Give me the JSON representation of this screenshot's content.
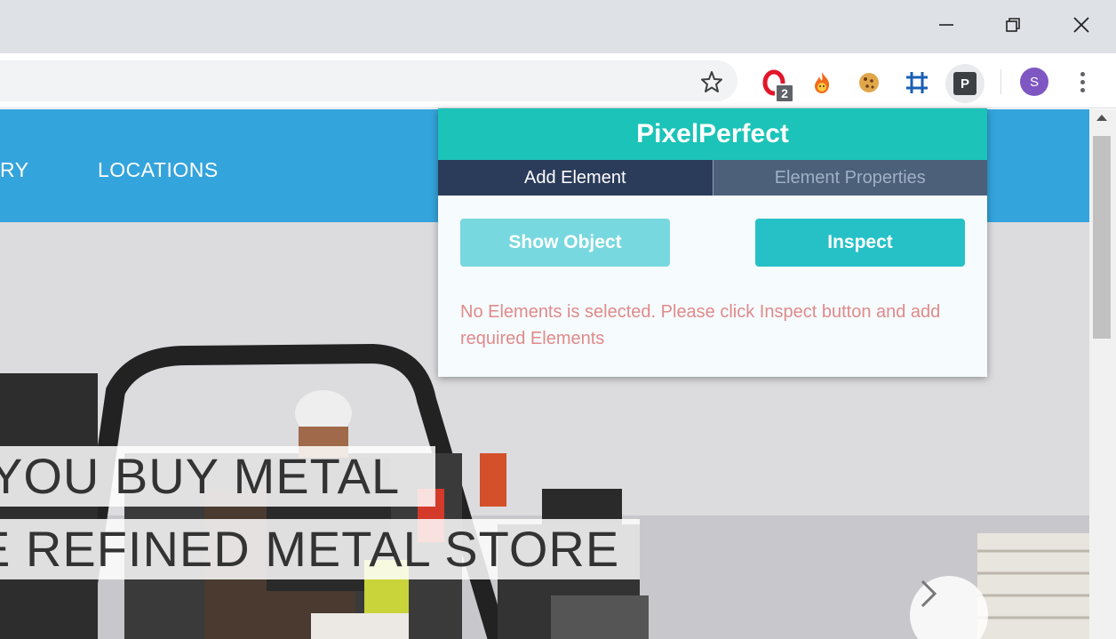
{
  "window": {
    "minimize_icon": "minimize-icon",
    "restore_icon": "restore-icon",
    "close_icon": "close-icon"
  },
  "toolbar": {
    "extensions": {
      "opera_badge": "2",
      "pixelperfect_letter": "P"
    },
    "profile_initial": "S"
  },
  "page": {
    "nav": {
      "partial_item": "RY",
      "locations": "LOCATIONS"
    },
    "hero": {
      "caption_line1": "YOU BUY METAL",
      "caption_line2": "E REFINED METAL STORE"
    }
  },
  "popup": {
    "title": "PixelPerfect",
    "tabs": [
      {
        "label": "Add Element",
        "active": true
      },
      {
        "label": "Element Properties",
        "active": false
      }
    ],
    "show_object_label": "Show Object",
    "inspect_label": "Inspect",
    "message": "No Elements is selected. Please click Inspect button and add required Elements"
  },
  "colors": {
    "popup_header": "#1bc3b8",
    "tab_active": "#2b3b5a",
    "tab_inactive": "#4c6079",
    "show_object_button": "#78d8df",
    "inspect_button": "#26c1c7",
    "message_text": "#e08a8a",
    "site_nav": "#34a4dc",
    "avatar": "#7e57c2"
  }
}
